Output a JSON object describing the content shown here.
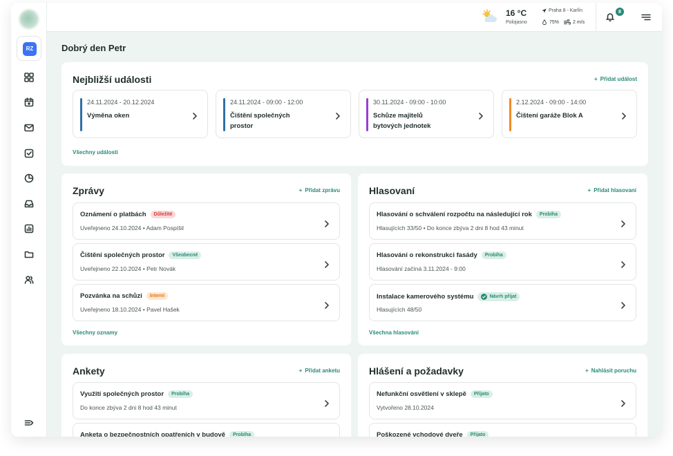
{
  "sidebar": {
    "org_initials": "RZ",
    "nav_icons": [
      "dashboard-icon",
      "calendar-icon",
      "mail-icon",
      "checklist-icon",
      "pie-chart-icon",
      "inbox-icon",
      "report-icon",
      "folder-icon",
      "users-icon"
    ],
    "collapse_icon": "collapse-sidebar-icon"
  },
  "topbar": {
    "temperature": "16 °C",
    "condition": "Polojasno",
    "location": "Praha 8 - Karlín",
    "humidity": "75%",
    "wind": "2 m/s",
    "notification_count": "8"
  },
  "greeting": "Dobrý den Petr",
  "events": {
    "title": "Nejbližší události",
    "add_label": "Přidat událost",
    "all_label": "Všechny události",
    "items": [
      {
        "date": "24.11.2024 - 20.12.2024",
        "name": "Výměna oken",
        "color": "#2f6fa7"
      },
      {
        "date": "24.11.2024 - 09:00 - 12:00",
        "name": "Čištění společných prostor",
        "color": "#2f6fa7"
      },
      {
        "date": "30.11.2024 - 09:00 - 10:00",
        "name": "Schůze majitelů bytových jednotek",
        "color": "#9b3fd1"
      },
      {
        "date": "2.12.2024 - 09:00 - 14:00",
        "name": "Čištení garáže Blok A",
        "color": "#f08a24"
      }
    ]
  },
  "messages": {
    "title": "Zprávy",
    "add_label": "Přidat zprávu",
    "all_label": "Všechny oznamy",
    "items": [
      {
        "title": "Oznámení o platbách",
        "tag": "Důležité",
        "sub": "Uveřejneno 24.10.2024 • Adam Pospíšil"
      },
      {
        "title": "Čištění společných prostor",
        "tag": "Všeobecné",
        "sub": "Uveřejneno 22.10.2024 • Petr Novák"
      },
      {
        "title": "Pozvánka na schůzi",
        "tag": "Interní",
        "sub": "Uveřejneno 18.10.2024 • Pavel Hašek"
      }
    ]
  },
  "votes": {
    "title": "Hlasovaní",
    "add_label": "Přidat hlasovaní",
    "all_label": "Všechna hlasování",
    "items": [
      {
        "title": "Hlasování o schválení rozpočtu na následující rok",
        "tag": "Probíha",
        "sub": "Hlasujících 33/50 • Do konce zbýva 2 dni 8 hod 43 minut"
      },
      {
        "title": "Hlasování o rekonstrukci fasády",
        "tag": "Probíha",
        "sub": "Hlasování začíná 3.11.2024 - 9:00"
      },
      {
        "title": "Instalace kamerového systému",
        "tag": "Návrh přijat",
        "sub": "Hlasujících 48/50"
      }
    ]
  },
  "polls": {
    "title": "Ankety",
    "add_label": "Přidat anketu",
    "items": [
      {
        "title": "Využití společných prostor",
        "tag": "Probíha",
        "sub": "Do konce zbýva 2 dni 8 hod 43 minut"
      },
      {
        "title": "Anketa o bezpečnostních opatřeních v budově",
        "tag": "Probíha",
        "sub": ""
      }
    ]
  },
  "reports": {
    "title": "Hlášení a požadavky",
    "add_label": "Nahlásit poruchu",
    "items": [
      {
        "title": "Nefunkční osvětlení v sklepě",
        "tag": "Přijato",
        "sub": "Vytvořeno 28.10.2024"
      },
      {
        "title": "Poškozené vchodové dveře",
        "tag": "Přijato",
        "sub": ""
      }
    ]
  },
  "colors": {
    "accent": "#2a8a78",
    "important": "#d23b3b",
    "internal": "#e0771d",
    "org_badge": "#3b73f5"
  }
}
